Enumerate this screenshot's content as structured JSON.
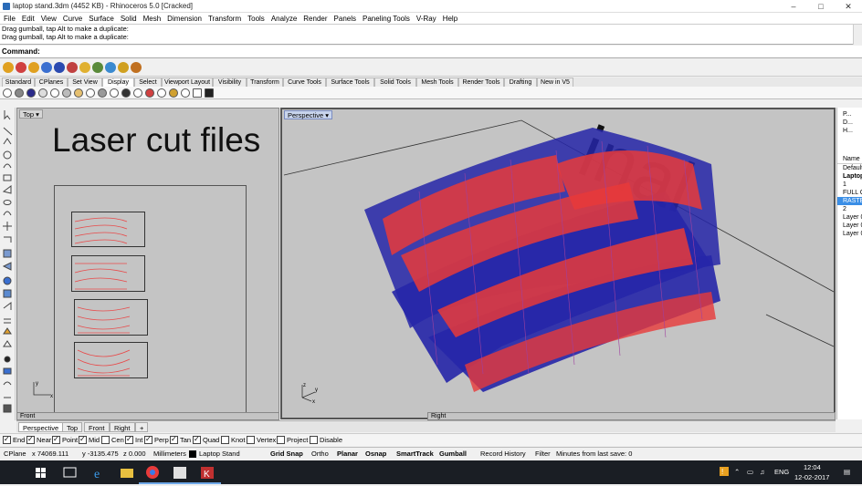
{
  "window": {
    "title": "laptop stand.3dm (4452 KB) - Rhinoceros 5.0 [Cracked]",
    "minimize_icon": "minimize-icon",
    "maximize_icon": "maximize-icon",
    "close_icon": "close-icon"
  },
  "menu": [
    "File",
    "Edit",
    "View",
    "Curve",
    "Surface",
    "Solid",
    "Mesh",
    "Dimension",
    "Transform",
    "Tools",
    "Analyze",
    "Render",
    "Panels",
    "Paneling Tools",
    "V-Ray",
    "Help"
  ],
  "command_history": [
    "Drag gumball, tap Alt to make a duplicate:",
    "Drag gumball, tap Alt to make a duplicate:"
  ],
  "command": {
    "label": "Command:",
    "value": ""
  },
  "toolbar_tabs": [
    "Standard",
    "CPlanes",
    "Set View",
    "Display",
    "Select",
    "Viewport Layout",
    "Visibility",
    "Transform",
    "Curve Tools",
    "Surface Tools",
    "Solid Tools",
    "Mesh Tools",
    "Render Tools",
    "Drafting",
    "New in V5"
  ],
  "toolbar_active_tab": "Display",
  "viewports": {
    "top": {
      "label": "Top",
      "text": "Laser cut files",
      "axis_x": "x",
      "axis_y": "y"
    },
    "perspective": {
      "label": "Perspective",
      "axis_x": "x",
      "axis_y": "y",
      "axis_z": "z"
    },
    "front": {
      "label": "Front"
    },
    "right": {
      "label": "Right"
    }
  },
  "layers_panel": {
    "tabs": [
      "P...",
      "D...",
      "H..."
    ],
    "header": "Name",
    "items": [
      "Default",
      "Laptop",
      "1",
      "FULL C",
      "RASTE",
      "2",
      "Layer 0",
      "Layer 0",
      "Layer 0"
    ],
    "selected_index": 4
  },
  "viewport_tabs": [
    "Perspective",
    "Top",
    "Front",
    "Right"
  ],
  "viewport_tabs_active": "Perspective",
  "viewport_tab_add": "+",
  "osnaps": [
    {
      "label": "End",
      "on": true
    },
    {
      "label": "Near",
      "on": true
    },
    {
      "label": "Point",
      "on": true
    },
    {
      "label": "Mid",
      "on": true
    },
    {
      "label": "Cen",
      "on": false
    },
    {
      "label": "Int",
      "on": true
    },
    {
      "label": "Perp",
      "on": true
    },
    {
      "label": "Tan",
      "on": true
    },
    {
      "label": "Quad",
      "on": true
    },
    {
      "label": "Knot",
      "on": false
    },
    {
      "label": "Vertex",
      "on": false
    },
    {
      "label": "Project",
      "on": false
    },
    {
      "label": "Disable",
      "on": false
    }
  ],
  "status": {
    "cplane": "CPlane",
    "x": "x 74069.111",
    "y": "y -3135.475",
    "z": "z 0.000",
    "units": "Millimeters",
    "layer": "Laptop Stand",
    "grid_snap": "Grid Snap",
    "ortho": "Ortho",
    "planar": "Planar",
    "osnap": "Osnap",
    "smarttrack": "SmartTrack",
    "gumball": "Gumball",
    "record_history": "Record History",
    "filter": "Filter",
    "save_info": "Minutes from last save: 0"
  },
  "taskbar": {
    "time": "12:04",
    "date": "12-02-2017",
    "lang": "ENG"
  },
  "colors": {
    "red": "#e83a3a",
    "blue": "#2626a8",
    "viewport_bg": "#c4c4c4",
    "selected_layer": "#3a8ee6"
  }
}
